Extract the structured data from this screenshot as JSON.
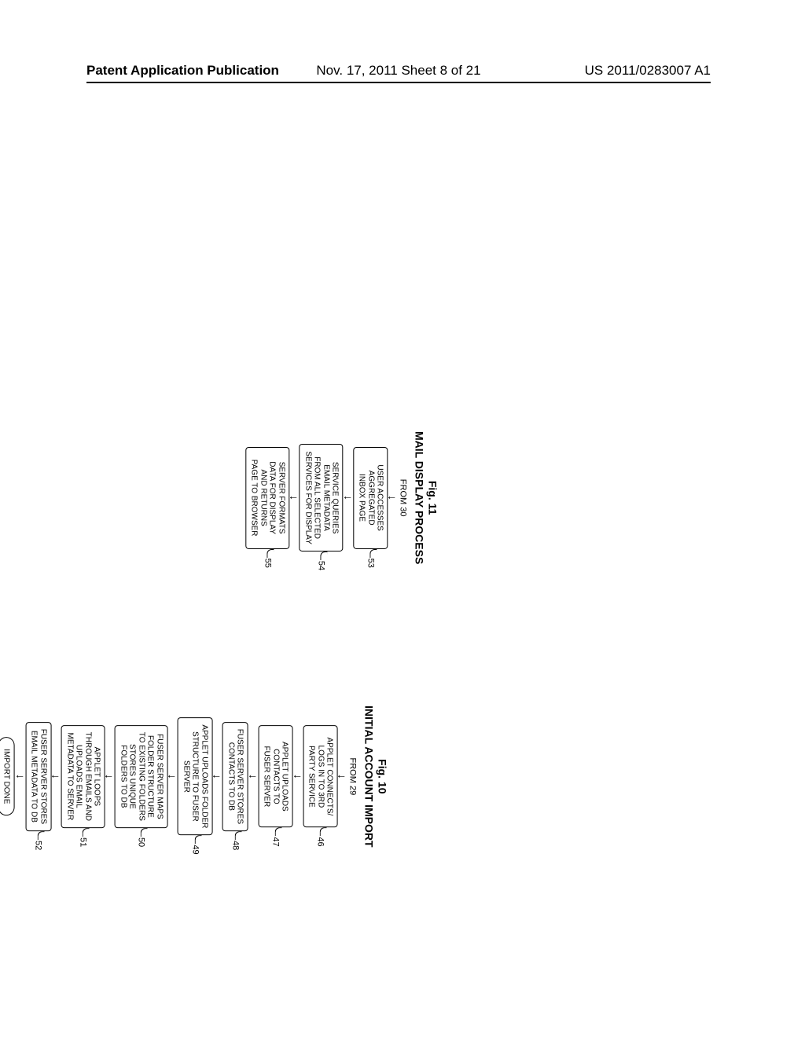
{
  "header": {
    "left": "Patent Application Publication",
    "center": "Nov. 17, 2011   Sheet 8 of 21",
    "right": "US 2011/0283007 A1"
  },
  "fig10": {
    "label": "Fig. 10",
    "title": "INITIAL ACCOUNT IMPORT",
    "from": "FROM 29",
    "steps": {
      "s46": {
        "ref": "46",
        "text": "APPLET CONNECTS/\nLOGS IN TO 3RD\nPARTY SERVICE"
      },
      "s47": {
        "ref": "47",
        "text": "APPLET UPLOADS\nCONTACTS TO\nFUSER SERVER"
      },
      "s48": {
        "ref": "48",
        "text": "FUSER SERVER STORES\nCONTACTS TO DB"
      },
      "s49": {
        "ref": "49",
        "text": "APPLET UPLOADS FOLDER\nSTRUCTURE TO FUSER\nSERVER"
      },
      "s50": {
        "ref": "50",
        "text": "FUSER SERVER MAPS\nFOLDER STRUCTURE\nTO EXISTING FOLDERS\nSTORES UNIQUE\nFOLDERS TO DB"
      },
      "s51": {
        "ref": "51",
        "text": "APPLET LOOPS\nTHROUGH EMAILS AND\nUPLOADS EMAIL\nMETADATA TO SERVER"
      },
      "s52": {
        "ref": "52",
        "text": "FUSER SERVER STORES\nEMAIL METADATA TO DB"
      }
    },
    "terminal": "IMPORT DONE"
  },
  "fig11": {
    "label": "Fig. 11",
    "title": "MAIL DISPLAY PROCESS",
    "from": "FROM 30",
    "steps": {
      "s53": {
        "ref": "53",
        "text": "USER ACCESSES\nAGGREGATED\nINBOX PAGE"
      },
      "s54": {
        "ref": "54",
        "text": "SERVICE QUERIES\nEMAIL METADATA\nFROM ALL SELECTED\nSERVICES FOR DISPLAY"
      },
      "s55": {
        "ref": "55",
        "text": "SERVER FORMATS\nDATA FOR DISPLAY\nAND RETURNS\nPAGE TO BROWSER"
      }
    }
  }
}
